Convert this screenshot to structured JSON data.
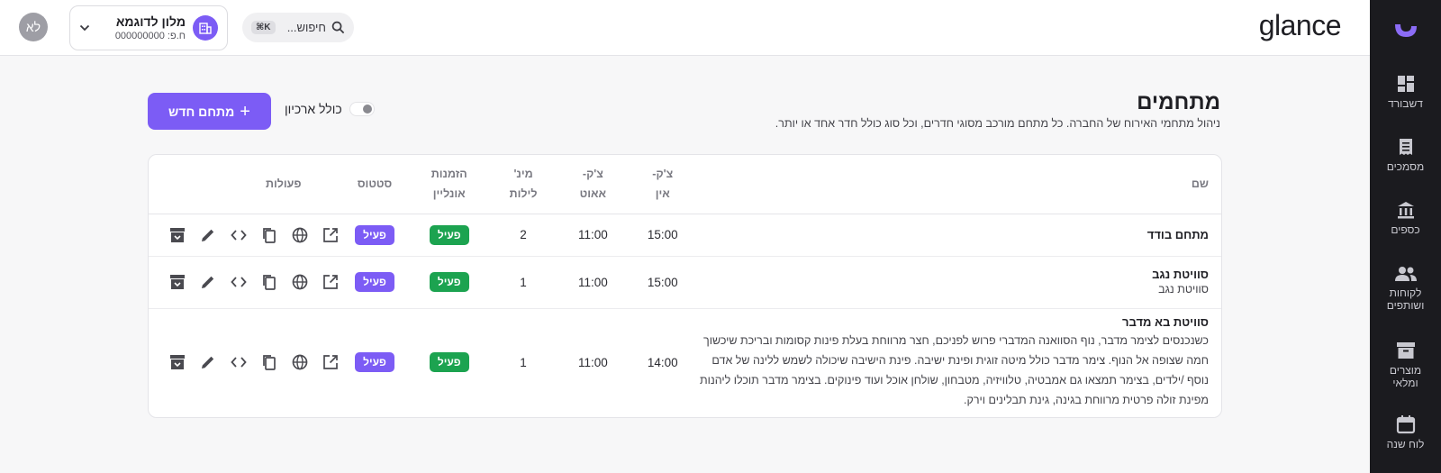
{
  "header": {
    "brand": "glance",
    "avatar_initials": "לא",
    "hotel_name": "מלון לדוגמא",
    "hotel_id": "ח.פ: 000000000",
    "search_placeholder": "חיפוש...",
    "search_shortcut": "⌘K"
  },
  "sidebar": {
    "items": [
      {
        "label": "דשבורד",
        "icon": "dashboard-icon"
      },
      {
        "label": "מסמכים",
        "icon": "receipt-icon"
      },
      {
        "label": "כספים",
        "icon": "bank-icon"
      },
      {
        "label": "לקוחות ושותפים",
        "icon": "people-icon"
      },
      {
        "label": "מוצרים ומלאי",
        "icon": "inventory-icon"
      },
      {
        "label": "לוח שנה",
        "icon": "calendar-icon"
      }
    ]
  },
  "page": {
    "title": "מתחמים",
    "description": "ניהול מתחמי האירוח של החברה. כל מתחם מורכב מסוגי חדרים, וכל סוג כולל חדר אחד או יותר.",
    "new_button": "מתחם חדש",
    "archive_toggle": "כולל ארכיון"
  },
  "table": {
    "headers": {
      "name": "שם",
      "checkin_1": "צ'ק-",
      "checkin_2": "אין",
      "checkout_1": "צ'ק-",
      "checkout_2": "אאוט",
      "minnights_1": "מינ'",
      "minnights_2": "לילות",
      "online_1": "הזמנות",
      "online_2": "אונליין",
      "status": "סטטוס",
      "actions": "פעולות"
    },
    "rows": [
      {
        "name": "מתחם בודד",
        "desc": "",
        "checkin": "15:00",
        "checkout": "11:00",
        "min_nights": "2",
        "online": "פעיל",
        "status": "פעיל"
      },
      {
        "name": "סוויטת נגב",
        "desc": "סוויטת נגב",
        "checkin": "15:00",
        "checkout": "11:00",
        "min_nights": "1",
        "online": "פעיל",
        "status": "פעיל"
      },
      {
        "name": "סוויטת בא מדבר",
        "desc": "כשנכנסים לצימר מדבר, נוף הסוואנה המדברי פרוש לפניכם, חצר מרווחת בעלת פינות קסומות ובריכת שיכשוך חמה שצופה אל הנוף. צימר מדבר כולל מיטה זוגית ופינת ישיבה. פינת הישיבה שיכולה לשמש ללינה של אדם נוסף /ילדים, בצימר תמצאו גם אמבטיה, טלוויזיה, מטבחון, שולחן אוכל ועוד פינוקים. בצימר מדבר תוכלו ליהנות מפינת זולה פרטית מרווחת בגינה, גינת תבלינים וירק.",
        "checkin": "14:00",
        "checkout": "11:00",
        "min_nights": "1",
        "online": "פעיל",
        "status": "פעיל"
      }
    ]
  },
  "colors": {
    "accent": "#7c5cf5",
    "active_green": "#1ca350",
    "sidebar_bg": "#1b1b1f"
  }
}
